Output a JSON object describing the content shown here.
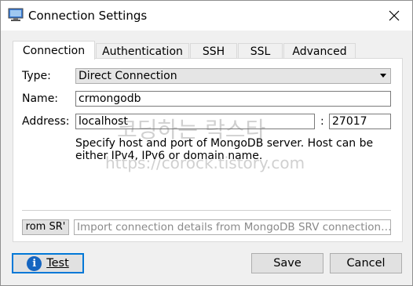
{
  "window": {
    "title": "Connection Settings"
  },
  "tabs": [
    {
      "label": "Connection"
    },
    {
      "label": "Authentication"
    },
    {
      "label": "SSH"
    },
    {
      "label": "SSL"
    },
    {
      "label": "Advanced"
    }
  ],
  "connection": {
    "type_label": "Type:",
    "type_value": "Direct Connection",
    "name_label": "Name:",
    "name_value": "crmongodb",
    "address_label": "Address:",
    "host_value": "localhost",
    "port_separator": ":",
    "port_value": "27017",
    "hint_line1": "Specify host and port of MongoDB server. Host can be",
    "hint_line2": "either IPv4, IPv6 or domain name.",
    "srv_button_label": "rom SR'",
    "srv_placeholder": "Import connection details from MongoDB SRV connection…"
  },
  "watermark": {
    "korean": "코딩하는 락스타",
    "url": "https://corock.tistory.com"
  },
  "buttons": {
    "test": "Test",
    "save": "Save",
    "cancel": "Cancel"
  },
  "colors": {
    "accent": "#0078d7",
    "info": "#1565c0"
  }
}
